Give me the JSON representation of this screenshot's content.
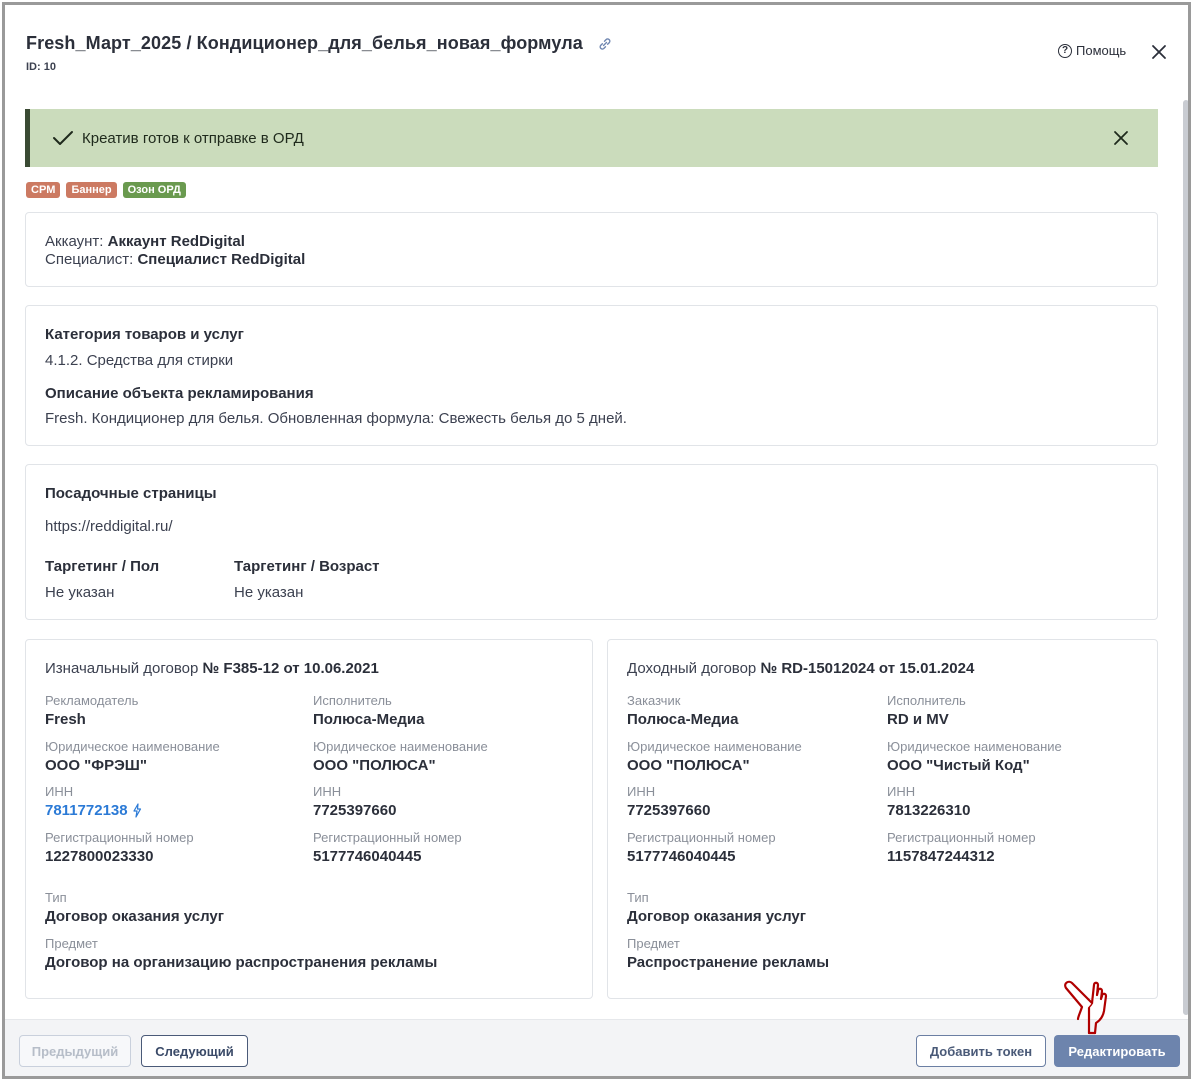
{
  "header": {
    "title": "Fresh_Март_2025 / Кондиционер_для_белья_новая_формула",
    "id_label": "ID: 10",
    "help_label": "Помощь"
  },
  "alert": {
    "text": "Креатив готов к отправке в ОРД"
  },
  "tags": [
    {
      "label": "CPM",
      "color": "#cc7a62"
    },
    {
      "label": "Баннер",
      "color": "#cc7a62"
    },
    {
      "label": "Озон ОРД",
      "color": "#6a9a4f"
    }
  ],
  "account": {
    "account_label": "Аккаунт: ",
    "account_value": "Аккаунт RedDigital",
    "specialist_label": "Специалист: ",
    "specialist_value": "Специалист RedDigital"
  },
  "category": {
    "category_heading": "Категория товаров и услуг",
    "category_value": "4.1.2. Средства для стирки",
    "description_heading": "Описание объекта рекламирования",
    "description_value": "Fresh. Кондиционер для белья. Обновленная формула: Свежесть белья до 5 дней."
  },
  "landing": {
    "heading": "Посадочные страницы",
    "url": "https://reddigital.ru/",
    "gender_heading": "Таргетинг / Пол",
    "gender_value": "Не указан",
    "age_heading": "Таргетинг / Возраст",
    "age_value": "Не указан"
  },
  "initial_contract": {
    "title_prefix": "Изначальный договор ",
    "title_number": "№ F385-12 от 10.06.2021",
    "left_role": "Рекламодатель",
    "left_name": "Fresh",
    "left_legal_label": "Юридическое наименование",
    "left_legal": "ООО \"ФРЭШ\"",
    "left_inn_label": "ИНН",
    "left_inn": "7811772138",
    "left_reg_label": "Регистрационный номер",
    "left_reg": "1227800023330",
    "right_role": "Исполнитель",
    "right_name": "Полюса-Медиа",
    "right_legal_label": "Юридическое наименование",
    "right_legal": "ООО \"ПОЛЮСА\"",
    "right_inn_label": "ИНН",
    "right_inn": "7725397660",
    "right_reg_label": "Регистрационный номер",
    "right_reg": "5177746040445",
    "type_label": "Тип",
    "type_value": "Договор оказания услуг",
    "subject_label": "Предмет",
    "subject_value": "Договор на организацию распространения рекламы"
  },
  "income_contract": {
    "title_prefix": "Доходный договор ",
    "title_number": "№ RD-15012024 от 15.01.2024",
    "left_role": "Заказчик",
    "left_name": "Полюса-Медиа",
    "left_legal_label": "Юридическое наименование",
    "left_legal": "ООО \"ПОЛЮСА\"",
    "left_inn_label": "ИНН",
    "left_inn": "7725397660",
    "left_reg_label": "Регистрационный номер",
    "left_reg": "5177746040445",
    "right_role": "Исполнитель",
    "right_name": "RD и MV",
    "right_legal_label": "Юридическое наименование",
    "right_legal": "ООО \"Чистый Код\"",
    "right_inn_label": "ИНН",
    "right_inn": "7813226310",
    "right_reg_label": "Регистрационный номер",
    "right_reg": "1157847244312",
    "type_label": "Тип",
    "type_value": "Договор оказания услуг",
    "subject_label": "Предмет",
    "subject_value": "Распространение рекламы"
  },
  "footer": {
    "prev_label": "Предыдущий",
    "next_label": "Следующий",
    "token_label": "Добавить токен",
    "edit_label": "Редактировать"
  },
  "colors": {
    "alert_bg": "#cbdcbc",
    "primary_button": "#6d84ad",
    "link": "#2b7ad6",
    "cursor_hand": "#b00000"
  }
}
